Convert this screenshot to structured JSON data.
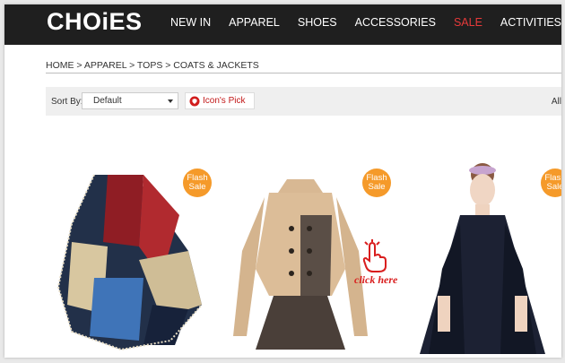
{
  "brand": {
    "logo": "CHOiES"
  },
  "nav": {
    "items": [
      {
        "label": "NEW IN"
      },
      {
        "label": "APPAREL"
      },
      {
        "label": "SHOES"
      },
      {
        "label": "ACCESSORIES"
      },
      {
        "label": "SALE"
      },
      {
        "label": "ACTIVITIES"
      }
    ],
    "highlight_color": "#e63a3a"
  },
  "breadcrumb": "HOME > APPAREL > TOPS > COATS & JACKETS",
  "sortbar": {
    "sort_label": "Sort By:",
    "sort_value": "Default",
    "pick_label": "Icon's Pick",
    "all_label": "All"
  },
  "products": [
    {
      "badge": [
        "Flash",
        "Sale"
      ],
      "image": "colorblock-poncho-cape"
    },
    {
      "badge": [
        "Flash",
        "Sale"
      ],
      "image": "beige-peplum-trench-coat"
    },
    {
      "badge": [
        "Flash",
        "Sale"
      ],
      "image": "navy-cape-coat-model"
    }
  ],
  "overlay": {
    "cta": "click here",
    "icon": "pointing-hand-icon",
    "color": "#d91e1e"
  },
  "colors": {
    "topbar": "#1f1f1f",
    "badge": "#f59a2a",
    "accent_red": "#c21818"
  }
}
